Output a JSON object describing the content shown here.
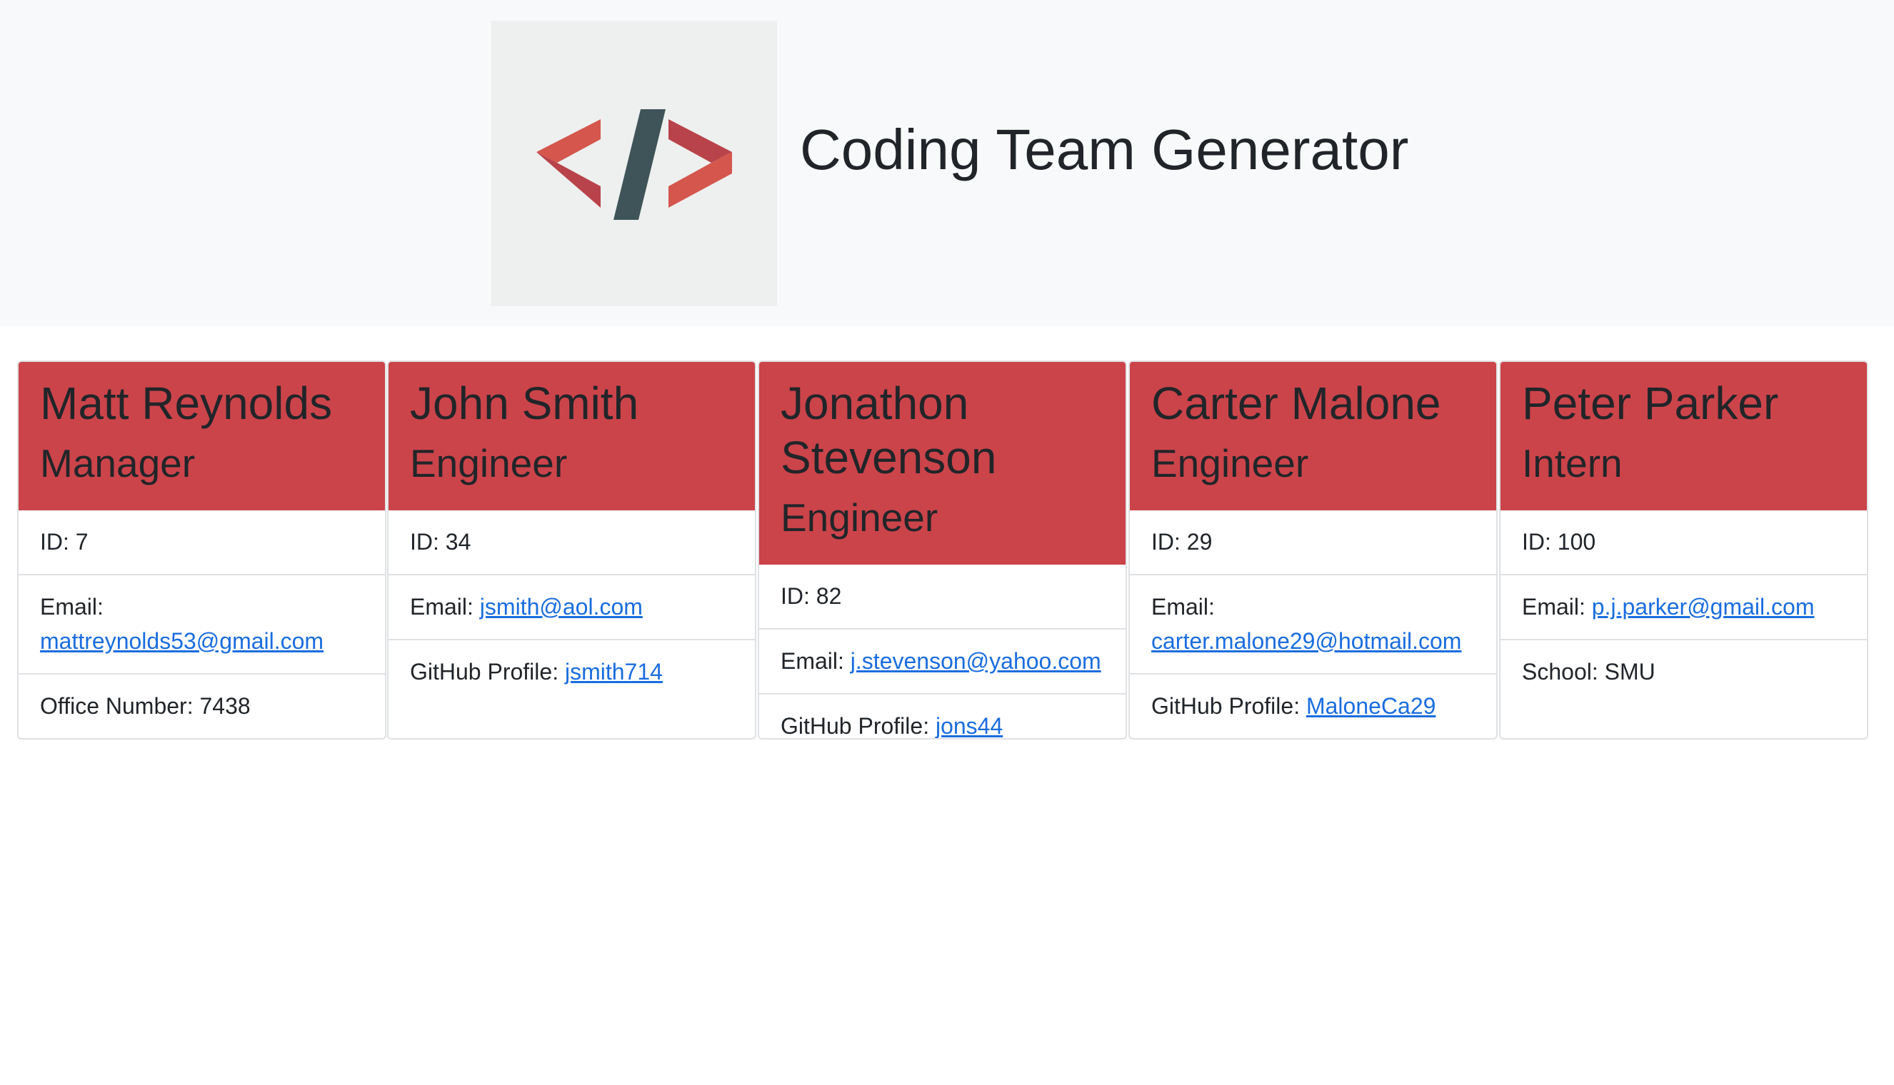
{
  "header": {
    "title": "Coding Team Generator",
    "logo_icon": "code-brackets-icon",
    "colors": {
      "background": "#f8f9fa",
      "bracket": "#d4564d",
      "slash": "#3f5459"
    }
  },
  "accent_color": "#cb444a",
  "link_color": "#1a6dde",
  "cards": [
    {
      "name": "Matt Reynolds",
      "role": "Manager",
      "id_text": "ID: 7",
      "email_label": "Email:",
      "email": "mattreynolds53@gmail.com",
      "extra_label": "Office Number: 7438",
      "extra_link": ""
    },
    {
      "name": "John Smith",
      "role": "Engineer",
      "id_text": "ID: 34",
      "email_label": "Email:",
      "email": "jsmith@aol.com",
      "extra_label": "GitHub Profile:",
      "extra_link": "jsmith714"
    },
    {
      "name": "Jonathon Stevenson",
      "role": "Engineer",
      "id_text": "ID: 82",
      "email_label": "Email:",
      "email": "j.stevenson@yahoo.com",
      "extra_label": "GitHub Profile:",
      "extra_link": "jons44"
    },
    {
      "name": "Carter Malone",
      "role": "Engineer",
      "id_text": "ID: 29",
      "email_label": "Email:",
      "email": "carter.malone29@hotmail.com",
      "extra_label": "GitHub Profile:",
      "extra_link": "MaloneCa29"
    },
    {
      "name": "Peter Parker",
      "role": "Intern",
      "id_text": "ID: 100",
      "email_label": "Email:",
      "email": "p.j.parker@gmail.com",
      "extra_label": "School: SMU",
      "extra_link": ""
    }
  ]
}
